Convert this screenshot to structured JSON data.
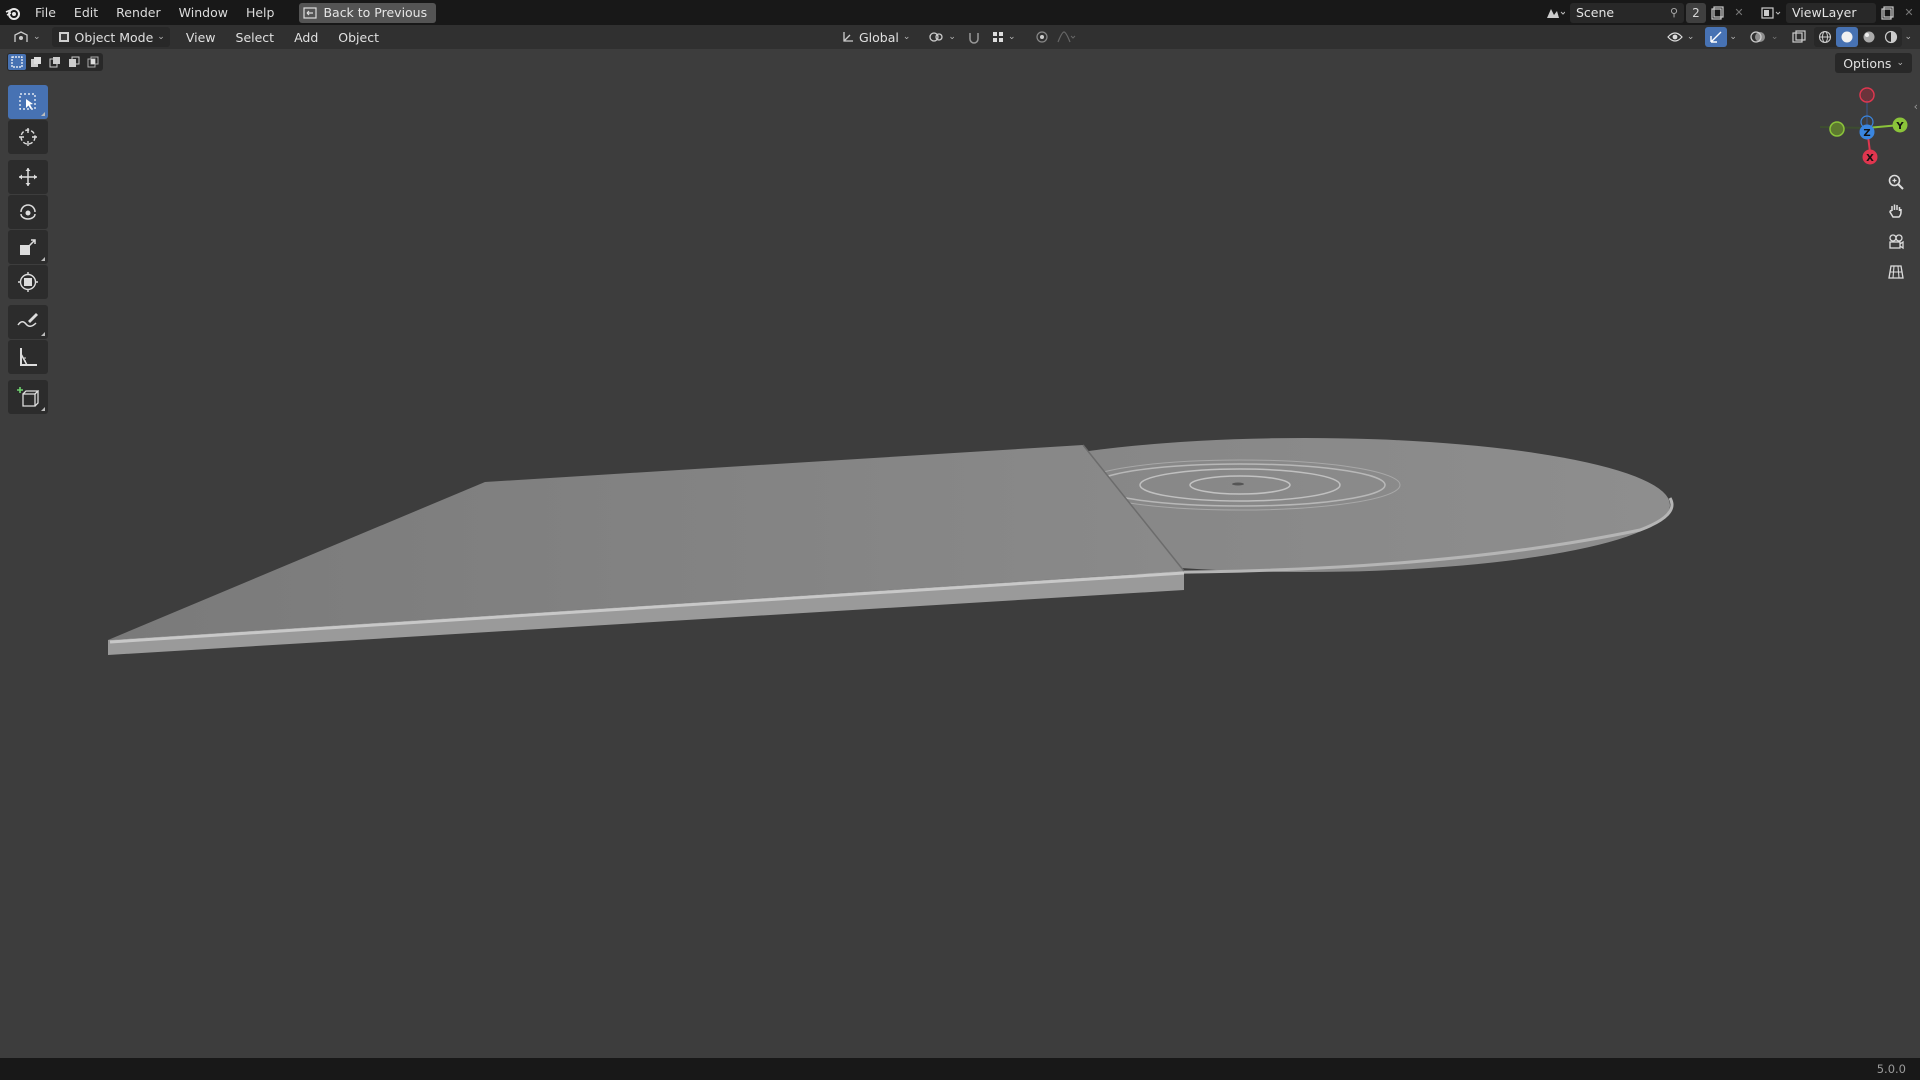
{
  "topbar": {
    "menus": [
      "File",
      "Edit",
      "Render",
      "Window",
      "Help"
    ],
    "back_label": "Back to Previous",
    "scene_name": "Scene",
    "scene_users": "2",
    "view_layer": "ViewLayer"
  },
  "header": {
    "mode": "Object Mode",
    "menus": [
      "View",
      "Select",
      "Add",
      "Object"
    ],
    "orientation": "Global",
    "options_label": "Options"
  },
  "toolbar": {
    "tools": [
      "select-box",
      "cursor",
      "move",
      "rotate",
      "scale",
      "transform",
      "annotate",
      "measure",
      "add-cube"
    ]
  },
  "gizmo": {
    "axes": [
      "X",
      "Y",
      "Z"
    ]
  },
  "status": {
    "version": "5.0.0"
  },
  "colors": {
    "accent": "#4772b3",
    "axis_x": "#e0364f",
    "axis_y": "#8bc43a",
    "axis_z": "#3a86e0",
    "viewport_bg": "#3d3d3d"
  }
}
